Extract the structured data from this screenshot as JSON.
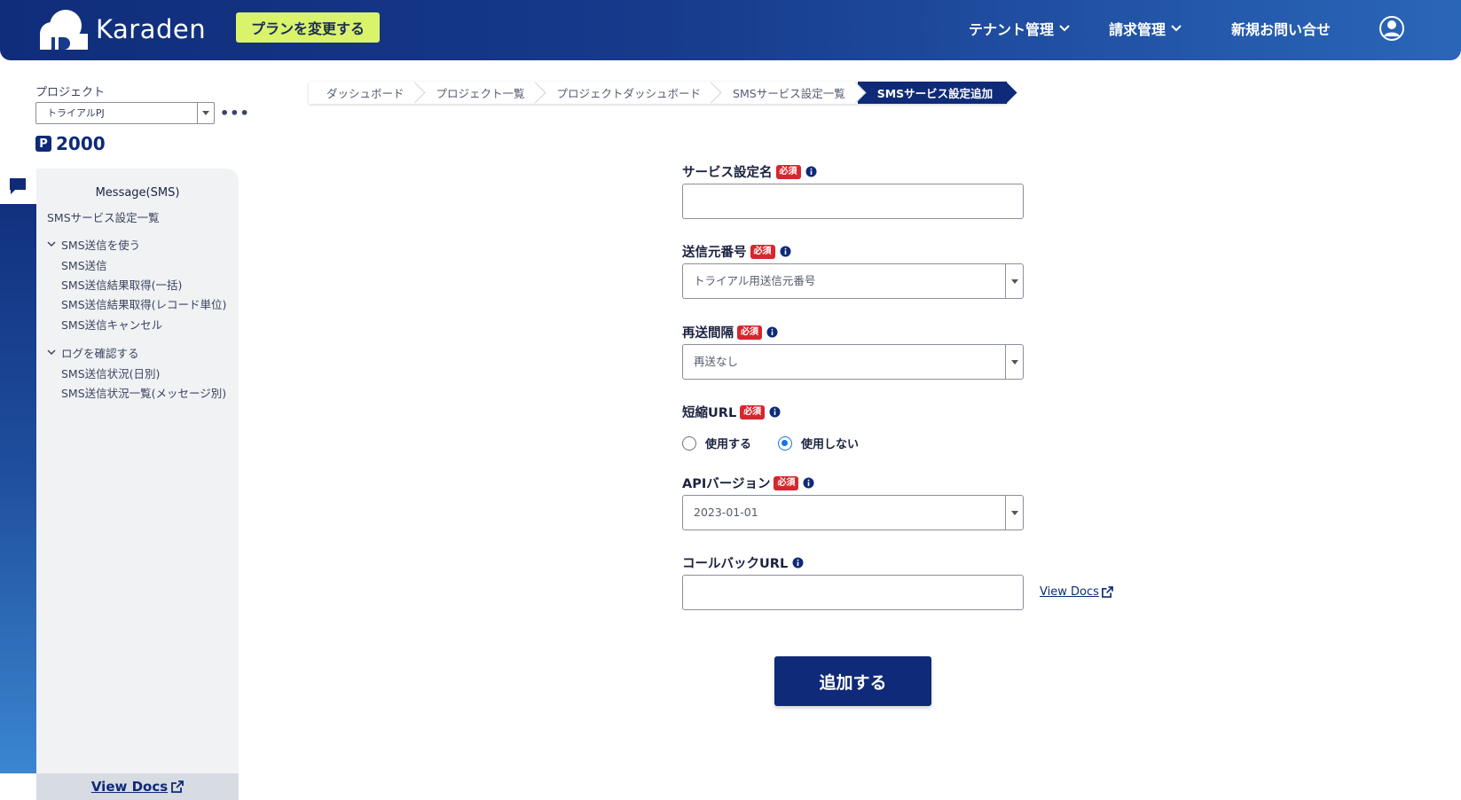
{
  "header": {
    "brand": "Karaden",
    "plan_button": "プランを変更する",
    "nav": [
      {
        "label": "テナント管理"
      },
      {
        "label": "請求管理"
      },
      {
        "label": "新規お問い合せ"
      }
    ],
    "icons": {
      "user": "user-circle-icon",
      "dropdown": "chevron-down-icon"
    },
    "colors": {
      "header_start": "#0f2d7a",
      "header_end": "#2a66b8",
      "plan_button": "#d9f36b",
      "accent": "#0e2a78",
      "required": "#d6262e"
    }
  },
  "project": {
    "label": "プロジェクト",
    "selected": "トライアルPJ",
    "more": "•••",
    "points_badge": "P",
    "points": "2000"
  },
  "sidebar": {
    "title": "Message(SMS)",
    "top_item": "SMSサービス設定一覧",
    "groups": [
      {
        "label": "SMS送信を使う",
        "items": [
          "SMS送信",
          "SMS送信結果取得(一括)",
          "SMS送信結果取得(レコード単位)",
          "SMS送信キャンセル"
        ]
      },
      {
        "label": "ログを確認する",
        "items": [
          "SMS送信状況(日別)",
          "SMS送信状況一覧(メッセージ別)"
        ]
      }
    ],
    "view_docs": "View Docs"
  },
  "breadcrumb": [
    "ダッシュボード",
    "プロジェクト一覧",
    "プロジェクトダッシュボード",
    "SMSサービス設定一覧",
    "SMSサービス設定追加"
  ],
  "form": {
    "required_badge": "必須",
    "service_name": {
      "label": "サービス設定名",
      "value": ""
    },
    "sender_number": {
      "label": "送信元番号",
      "value": "トライアル用送信元番号"
    },
    "resend_interval": {
      "label": "再送間隔",
      "value": "再送なし"
    },
    "short_url": {
      "label": "短縮URL",
      "options": [
        "使用する",
        "使用しない"
      ],
      "selected": "使用しない"
    },
    "api_version": {
      "label": "APIバージョン",
      "value": "2023-01-01"
    },
    "callback_url": {
      "label": "コールバックURL",
      "value": ""
    },
    "view_docs": "View Docs",
    "submit": "追加する"
  }
}
